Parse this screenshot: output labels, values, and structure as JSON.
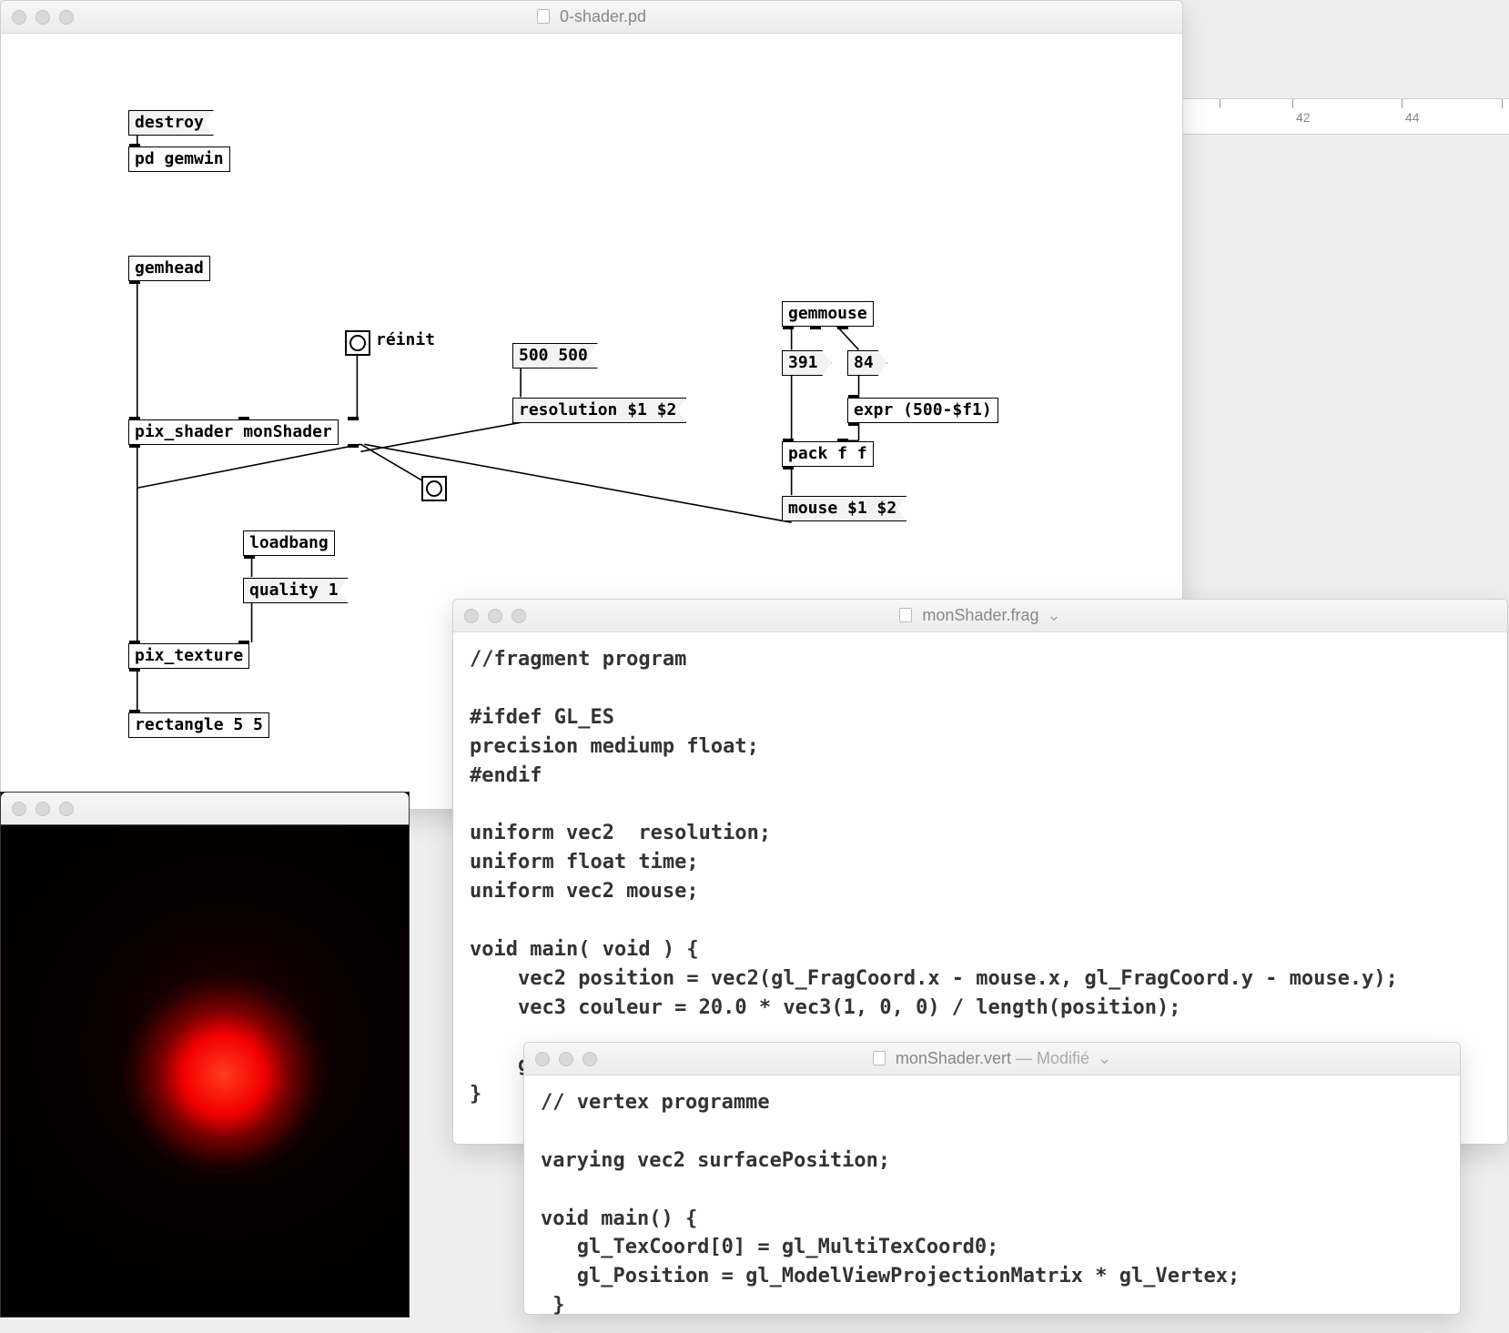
{
  "ruler": {
    "labels": [
      "42",
      "44"
    ]
  },
  "pd": {
    "title": "0-shader.pd",
    "boxes": {
      "destroy": "destroy",
      "pd_gemwin": "pd gemwin",
      "gemhead": "gemhead",
      "reinit_label": "réinit",
      "msg_500_500": "500 500",
      "resolution": "resolution $1 $2",
      "pix_shader": "pix_shader monShader",
      "gemmouse": "gemmouse",
      "num_x": "391",
      "num_y": "84",
      "expr": "expr (500-$f1)",
      "pack": "pack f f",
      "mouse": "mouse $1 $2",
      "loadbang": "loadbang",
      "quality": "quality 1",
      "pix_texture": "pix_texture",
      "rectangle": "rectangle 5 5"
    }
  },
  "frag": {
    "title": "monShader.frag",
    "code": "//fragment program\n\n#ifdef GL_ES\nprecision mediump float;\n#endif\n\nuniform vec2  resolution;\nuniform float time;\nuniform vec2 mouse;\n\nvoid main( void ) {\n    vec2 position = vec2(gl_FragCoord.x - mouse.x, gl_FragCoord.y - mouse.y);\n    vec3 couleur = 20.0 * vec3(1, 0, 0) / length(position);\n\n    gl_FragColor = vec4(couleur, 1);\n}"
  },
  "vert": {
    "title": "monShader.vert",
    "status": "— Modifié",
    "code": "// vertex programme\n\nvarying vec2 surfacePosition;\n\nvoid main() {\n   gl_TexCoord[0] = gl_MultiTexCoord0;\n   gl_Position = gl_ModelViewProjectionMatrix * gl_Vertex;\n }"
  }
}
